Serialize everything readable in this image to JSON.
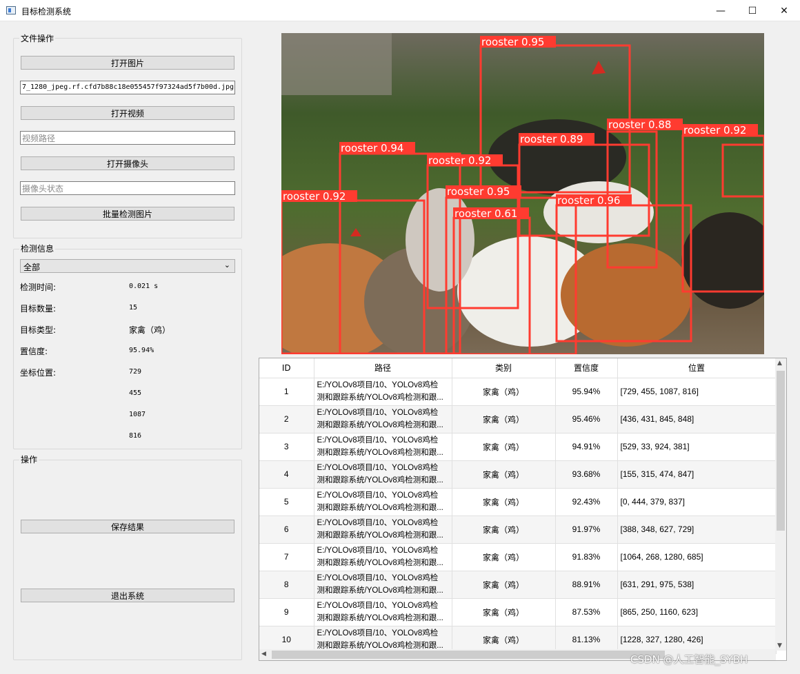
{
  "window": {
    "title": "目标检测系统",
    "minimize_glyph": "—",
    "maximize_glyph": "☐",
    "close_glyph": "✕"
  },
  "file_ops": {
    "group_title": "文件操作",
    "open_image_label": "打开图片",
    "image_path_value": "7_1280_jpeg.rf.cfd7b88c18e055457f97324ad5f7b00d.jpg",
    "open_video_label": "打开视频",
    "video_path_placeholder": "视频路径",
    "open_camera_label": "打开摄像头",
    "camera_status_placeholder": "摄像头状态",
    "batch_detect_label": "批量检测图片"
  },
  "detection_info": {
    "group_title": "检测信息",
    "filter_selected": "全部",
    "time_label": "检测时间:",
    "time_value": "0.021 s",
    "count_label": "目标数量:",
    "count_value": "15",
    "type_label": "目标类型:",
    "type_value": "家禽（鸡）",
    "confidence_label": "置信度:",
    "confidence_value": "95.94%",
    "position_label": "坐标位置:",
    "xmin": "729",
    "ymin": "455",
    "xmax": "1087",
    "ymax": "816"
  },
  "operations": {
    "group_title": "操作",
    "save_label": "保存结果",
    "exit_label": "退出系统"
  },
  "detections_overlay": [
    {
      "label": "rooster 0.95"
    },
    {
      "label": "rooster 0.88"
    },
    {
      "label": "rooster 0.92"
    },
    {
      "label": "rooster 0.89"
    },
    {
      "label": "rooster 0.94"
    },
    {
      "label": "rooster 0.92"
    },
    {
      "label": "rooster 0.95"
    },
    {
      "label": "rooster 0.92"
    },
    {
      "label": "rooster 0.61"
    },
    {
      "label": "rooster 0.96"
    }
  ],
  "table": {
    "headers": [
      "ID",
      "路径",
      "类别",
      "置信度",
      "位置"
    ],
    "rows": [
      {
        "id": "1",
        "path1": "E:/YOLOv8项目/10、YOLOv8鸡检",
        "path2": "测和跟踪系统/YOLOv8鸡检测和跟...",
        "cls": "家禽（鸡）",
        "conf": "95.94%",
        "pos": "[729, 455, 1087, 816]"
      },
      {
        "id": "2",
        "path1": "E:/YOLOv8项目/10、YOLOv8鸡检",
        "path2": "测和跟踪系统/YOLOv8鸡检测和跟...",
        "cls": "家禽（鸡）",
        "conf": "95.46%",
        "pos": "[436, 431, 845, 848]"
      },
      {
        "id": "3",
        "path1": "E:/YOLOv8项目/10、YOLOv8鸡检",
        "path2": "测和跟踪系统/YOLOv8鸡检测和跟...",
        "cls": "家禽（鸡）",
        "conf": "94.91%",
        "pos": "[529, 33, 924, 381]"
      },
      {
        "id": "4",
        "path1": "E:/YOLOv8项目/10、YOLOv8鸡检",
        "path2": "测和跟踪系统/YOLOv8鸡检测和跟...",
        "cls": "家禽（鸡）",
        "conf": "93.68%",
        "pos": "[155, 315, 474, 847]"
      },
      {
        "id": "5",
        "path1": "E:/YOLOv8项目/10、YOLOv8鸡检",
        "path2": "测和跟踪系统/YOLOv8鸡检测和跟...",
        "cls": "家禽（鸡）",
        "conf": "92.43%",
        "pos": "[0, 444, 379, 837]"
      },
      {
        "id": "6",
        "path1": "E:/YOLOv8项目/10、YOLOv8鸡检",
        "path2": "测和跟踪系统/YOLOv8鸡检测和跟...",
        "cls": "家禽（鸡）",
        "conf": "91.97%",
        "pos": "[388, 348, 627, 729]"
      },
      {
        "id": "7",
        "path1": "E:/YOLOv8项目/10、YOLOv8鸡检",
        "path2": "测和跟踪系统/YOLOv8鸡检测和跟...",
        "cls": "家禽（鸡）",
        "conf": "91.83%",
        "pos": "[1064, 268, 1280, 685]"
      },
      {
        "id": "8",
        "path1": "E:/YOLOv8项目/10、YOLOv8鸡检",
        "path2": "测和跟踪系统/YOLOv8鸡检测和跟...",
        "cls": "家禽（鸡）",
        "conf": "88.91%",
        "pos": "[631, 291, 975, 538]"
      },
      {
        "id": "9",
        "path1": "E:/YOLOv8项目/10、YOLOv8鸡检",
        "path2": "测和跟踪系统/YOLOv8鸡检测和跟...",
        "cls": "家禽（鸡）",
        "conf": "87.53%",
        "pos": "[865, 250, 1160, 623]"
      },
      {
        "id": "10",
        "path1": "E:/YOLOv8项目/10、YOLOv8鸡检",
        "path2": "测和跟踪系统/YOLOv8鸡检测和跟...",
        "cls": "家禽（鸡）",
        "conf": "81.13%",
        "pos": "[1228, 327, 1280, 426]"
      }
    ]
  },
  "watermark": "CSDN @人工智能_SYBH",
  "colors": {
    "bbox": "#ff3b30",
    "window_bg": "#f0f0f0",
    "button_bg": "#e1e1e1"
  }
}
